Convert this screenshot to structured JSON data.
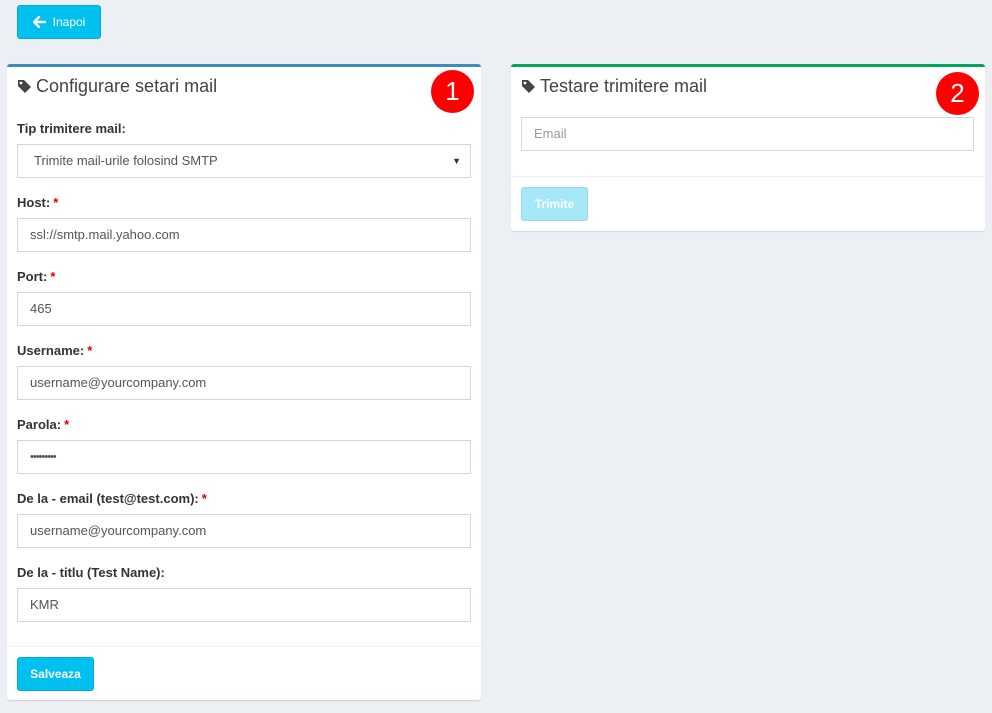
{
  "header": {
    "back_label": "Inapoi"
  },
  "config_panel": {
    "title": "Configurare setari mail",
    "step_badge": "1",
    "fields": {
      "send_type": {
        "label": "Tip trimitere mail:",
        "value": "Trimite mail-urile folosind SMTP"
      },
      "host": {
        "label": "Host:",
        "required": "*",
        "value": "ssl://smtp.mail.yahoo.com"
      },
      "port": {
        "label": "Port:",
        "required": "*",
        "value": "465"
      },
      "username": {
        "label": "Username:",
        "required": "*",
        "value": "username@yourcompany.com"
      },
      "password": {
        "label": "Parola:",
        "required": "*",
        "value": "•••••••••"
      },
      "from_email": {
        "label": "De la - email (test@test.com):",
        "required": "*",
        "value": "username@yourcompany.com"
      },
      "from_name": {
        "label": "De la - titlu (Test Name):",
        "value": "KMR"
      }
    },
    "save_label": "Salveaza"
  },
  "test_panel": {
    "title": "Testare trimitere mail",
    "step_badge": "2",
    "email_placeholder": "Email",
    "send_label": "Trimite"
  },
  "colors": {
    "accent": "#00c0ef",
    "left_box_border": "#3c8dbc",
    "right_box_border": "#00a65a",
    "badge": "#ff0000",
    "background": "#ecf0f5"
  },
  "icons": {
    "back": "arrow-left-icon",
    "title": "tag-icon"
  }
}
